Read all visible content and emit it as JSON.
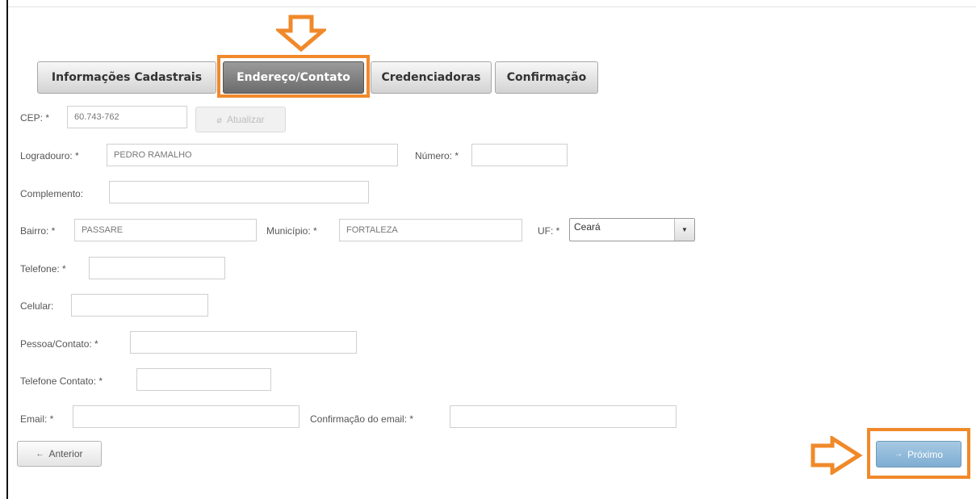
{
  "tabs": [
    {
      "label": "Informações Cadastrais",
      "active": false
    },
    {
      "label": "Endereço/Contato",
      "active": true
    },
    {
      "label": "Credenciadoras",
      "active": false
    },
    {
      "label": "Confirmação",
      "active": false
    }
  ],
  "form": {
    "cep": {
      "label": "CEP: *",
      "value": "60.743-762"
    },
    "update_button": {
      "icon": "refresh-icon",
      "label": "Atualizar",
      "disabled": true
    },
    "logradouro": {
      "label": "Logradouro: *",
      "value": "PEDRO RAMALHO"
    },
    "numero": {
      "label": "Número: *",
      "value": ""
    },
    "complemento": {
      "label": "Complemento:",
      "value": ""
    },
    "bairro": {
      "label": "Bairro: *",
      "value": "PASSARE"
    },
    "municipio": {
      "label": "Município: *",
      "value": "FORTALEZA"
    },
    "uf": {
      "label": "UF: *",
      "value": "Ceará"
    },
    "telefone": {
      "label": "Telefone: *",
      "value": ""
    },
    "celular": {
      "label": "Celular:",
      "value": ""
    },
    "pessoa_contato": {
      "label": "Pessoa/Contato: *",
      "value": ""
    },
    "telefone_contato": {
      "label": "Telefone Contato: *",
      "value": ""
    },
    "email": {
      "label": "Email: *",
      "value": ""
    },
    "email_confirm": {
      "label": "Confirmação do email: *",
      "value": ""
    }
  },
  "nav": {
    "prev": {
      "icon": "arrow-left-icon",
      "glyph": "←",
      "label": "Anterior"
    },
    "next": {
      "icon": "arrow-right-icon",
      "glyph": "→",
      "label": "Próximo"
    }
  },
  "annotations": {
    "color": "#f0892a"
  },
  "colors": {
    "active_tab": "#7a7a7a",
    "next_button": "#8db7d8"
  }
}
